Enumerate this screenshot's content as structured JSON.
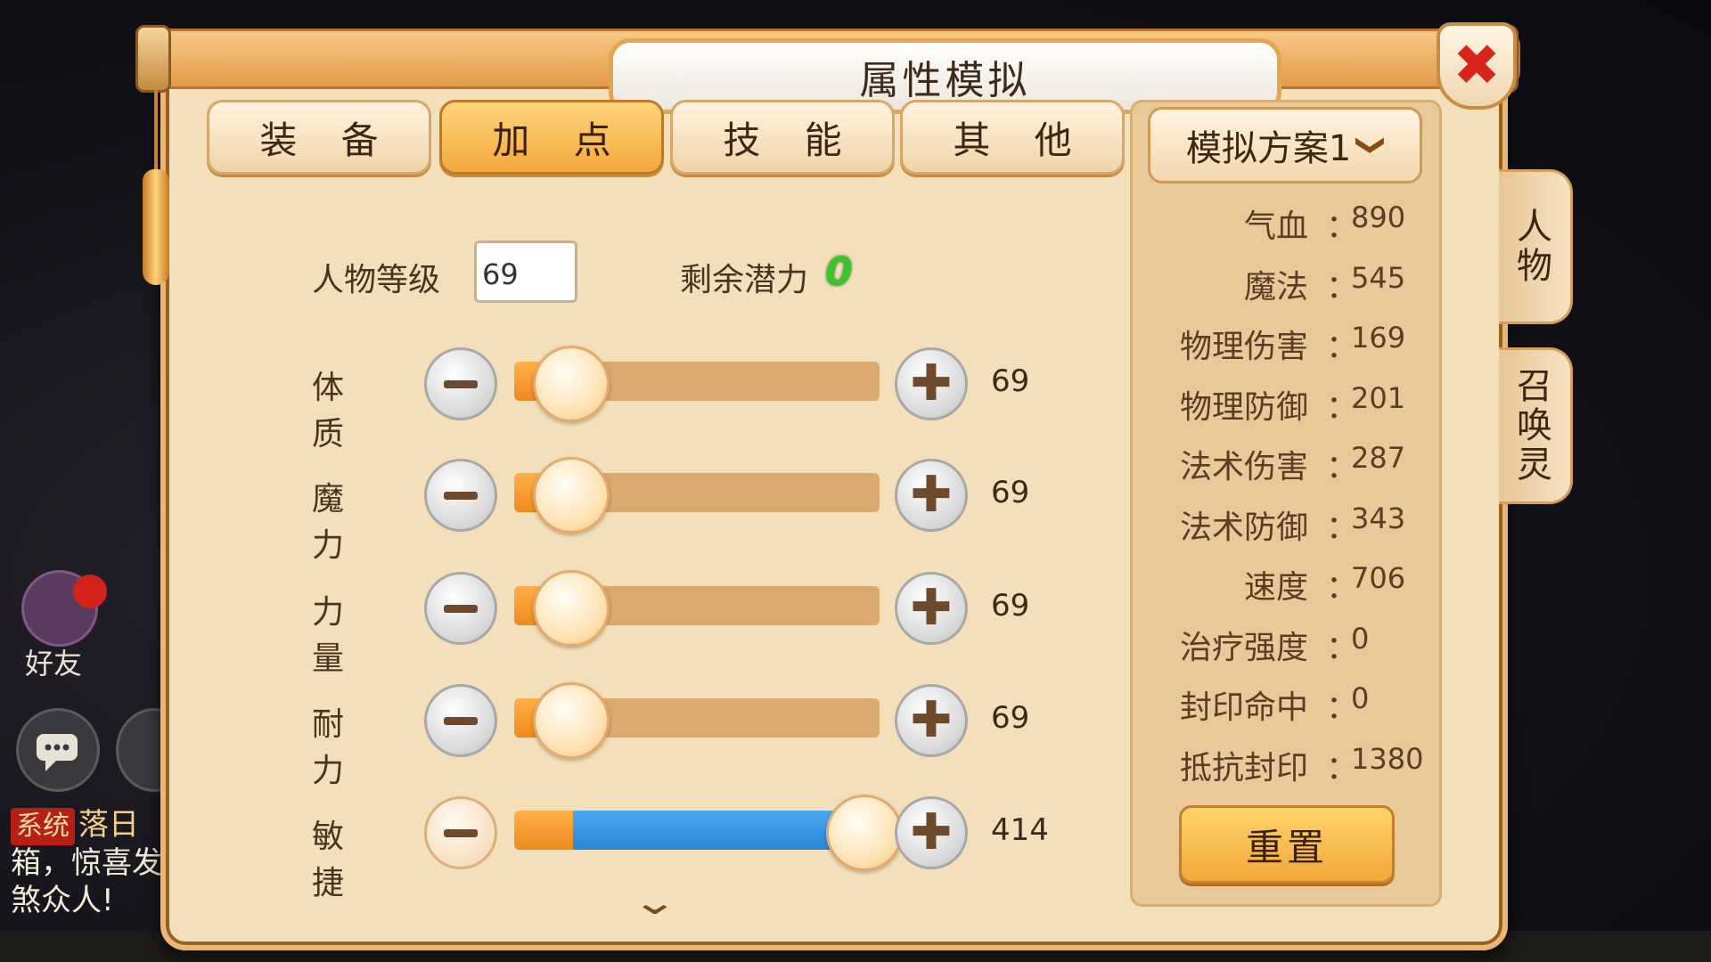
{
  "title": "属性模拟",
  "tabs": [
    {
      "label": "装 备",
      "active": false
    },
    {
      "label": "加 点",
      "active": true
    },
    {
      "label": "技 能",
      "active": false
    },
    {
      "label": "其 他",
      "active": false
    }
  ],
  "level": {
    "label": "人物等级",
    "value": "69"
  },
  "potential": {
    "label": "剩余潜力",
    "value": "0"
  },
  "stats": [
    {
      "label": "体质",
      "value": "69",
      "fill": 0.12,
      "highlight": false
    },
    {
      "label": "魔力",
      "value": "69",
      "fill": 0.12,
      "highlight": false
    },
    {
      "label": "力量",
      "value": "69",
      "fill": 0.12,
      "highlight": false
    },
    {
      "label": "耐力",
      "value": "69",
      "fill": 0.12,
      "highlight": false
    },
    {
      "label": "敏捷",
      "value": "414",
      "fill": 1.0,
      "highlight": true
    }
  ],
  "plan": {
    "label": "模拟方案1"
  },
  "attributes": [
    {
      "name": "气血",
      "value": "890"
    },
    {
      "name": "魔法",
      "value": "545"
    },
    {
      "name": "物理伤害",
      "value": "169"
    },
    {
      "name": "物理防御",
      "value": "201"
    },
    {
      "name": "法术伤害",
      "value": "287"
    },
    {
      "name": "法术防御",
      "value": "343"
    },
    {
      "name": "速度",
      "value": "706"
    },
    {
      "name": "治疗强度",
      "value": "0"
    },
    {
      "name": "封印命中",
      "value": "0"
    },
    {
      "name": "抵抗封印",
      "value": "1380"
    }
  ],
  "attr_colon": "：",
  "reset_label": "重置",
  "side_tabs": [
    {
      "label": "人\n物"
    },
    {
      "label": "召\n唤\n灵"
    }
  ],
  "background": {
    "friend_label": "好友",
    "chat": {
      "tag": "系统",
      "name": "落日",
      "line2": "箱，惊喜发",
      "line3": "煞众人!"
    }
  },
  "icons": {
    "close": "close-x-icon",
    "dropdown": "chevron-down-icon",
    "scroll": "chevron-down-icon"
  }
}
